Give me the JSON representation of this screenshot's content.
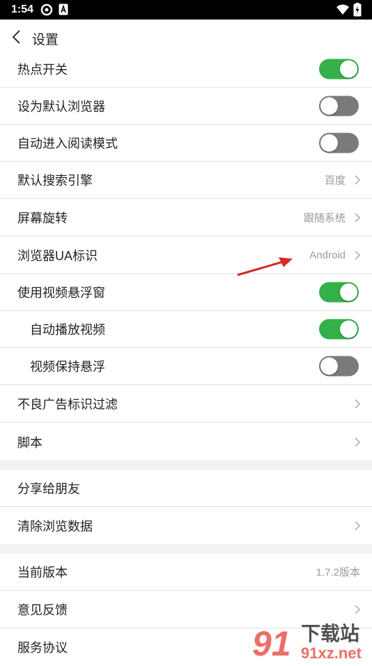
{
  "status_bar": {
    "time": "1:54"
  },
  "header": {
    "title": "设置"
  },
  "rows": {
    "hotspot": {
      "label": "热点开关",
      "on": true
    },
    "default_browser": {
      "label": "设为默认浏览器",
      "on": false
    },
    "auto_reader": {
      "label": "自动进入阅读模式",
      "on": false
    },
    "search_engine": {
      "label": "默认搜索引擎",
      "value": "百度"
    },
    "rotation": {
      "label": "屏幕旋转",
      "value": "跟随系统"
    },
    "ua": {
      "label": "浏览器UA标识",
      "value": "Android"
    },
    "float_video": {
      "label": "使用视频悬浮窗",
      "on": true
    },
    "autoplay": {
      "label": "自动播放视频",
      "on": true
    },
    "keep_float": {
      "label": "视频保持悬浮",
      "on": false
    },
    "ad_filter": {
      "label": "不良广告标识过滤"
    },
    "script": {
      "label": "脚本"
    },
    "share": {
      "label": "分享给朋友"
    },
    "clear_data": {
      "label": "清除浏览数据"
    },
    "version": {
      "label": "当前版本",
      "value": "1.7.2版本"
    },
    "feedback": {
      "label": "意见反馈"
    },
    "agreement": {
      "label": "服务协议"
    }
  },
  "watermark": {
    "mark": "91",
    "text_main": "下载站",
    "text_url": "91xz.net"
  },
  "colors": {
    "toggle_on": "#34b04a",
    "toggle_off": "#7a7a7a",
    "annotation_arrow": "#d42a2a"
  }
}
